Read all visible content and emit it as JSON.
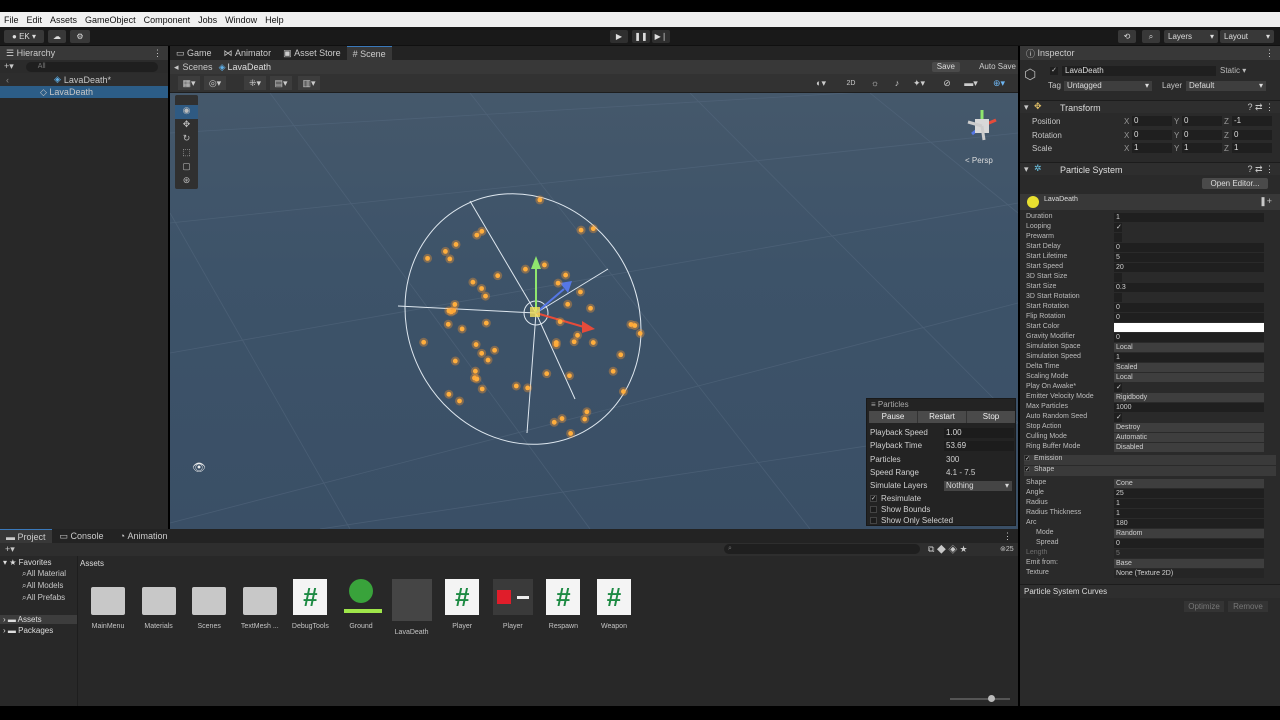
{
  "menu": [
    "File",
    "Edit",
    "Assets",
    "GameObject",
    "Component",
    "Jobs",
    "Window",
    "Help"
  ],
  "toolbar": {
    "account": "EK",
    "layers": "Layers",
    "layout": "Layout"
  },
  "hierarchy": {
    "title": "Hierarchy",
    "search_placeholder": "All",
    "scene": "LavaDeath*",
    "object": "LavaDeath"
  },
  "scene_tabs": [
    "Game",
    "Animator",
    "Asset Store",
    "Scene"
  ],
  "breadcrumb": {
    "root": "Scenes",
    "current": "LavaDeath"
  },
  "scene_header": {
    "save": "Save",
    "auto_save": "Auto Save",
    "mode_2d": "2D"
  },
  "viewport": {
    "persp": "Persp"
  },
  "particles_panel": {
    "title": "Particles",
    "buttons": [
      "Pause",
      "Restart",
      "Stop"
    ],
    "playback_speed_label": "Playback Speed",
    "playback_speed": "1.00",
    "playback_time_label": "Playback Time",
    "playback_time": "53.69",
    "particles_label": "Particles",
    "particles": "300",
    "speed_range_label": "Speed Range",
    "speed_range": "4.1 - 7.5",
    "simulate_layers_label": "Simulate Layers",
    "simulate_layers": "Nothing",
    "resimulate": "Resimulate",
    "show_bounds": "Show Bounds",
    "show_only_selected": "Show Only Selected"
  },
  "inspector": {
    "title": "Inspector",
    "object_name": "LavaDeath",
    "static": "Static",
    "tag_label": "Tag",
    "tag": "Untagged",
    "layer_label": "Layer",
    "layer": "Default",
    "transform": {
      "title": "Transform",
      "position_label": "Position",
      "position": [
        "0",
        "0",
        "-1"
      ],
      "rotation_label": "Rotation",
      "rotation": [
        "0",
        "0",
        "0"
      ],
      "scale_label": "Scale",
      "scale": [
        "1",
        "1",
        "1"
      ]
    },
    "particle_system": {
      "title": "Particle System",
      "open_editor": "Open Editor...",
      "module_name": "LavaDeath"
    },
    "props": [
      {
        "label": "Duration",
        "value": "1"
      },
      {
        "label": "Looping",
        "value": "✓"
      },
      {
        "label": "Prewarm",
        "value": ""
      },
      {
        "label": "Start Delay",
        "value": "0"
      },
      {
        "label": "Start Lifetime",
        "value": "5"
      },
      {
        "label": "Start Speed",
        "value": "20"
      },
      {
        "label": "3D Start Size",
        "value": ""
      },
      {
        "label": "Start Size",
        "value": "0.3"
      },
      {
        "label": "3D Start Rotation",
        "value": ""
      },
      {
        "label": "Start Rotation",
        "value": "0"
      },
      {
        "label": "Flip Rotation",
        "value": "0"
      },
      {
        "label": "Start Color",
        "value": ""
      },
      {
        "label": "Gravity Modifier",
        "value": "0"
      },
      {
        "label": "Simulation Space",
        "value": "Local"
      },
      {
        "label": "Simulation Speed",
        "value": "1"
      },
      {
        "label": "Delta Time",
        "value": "Scaled"
      },
      {
        "label": "Scaling Mode",
        "value": "Local"
      },
      {
        "label": "Play On Awake*",
        "value": "✓"
      },
      {
        "label": "Emitter Velocity Mode",
        "value": "Rigidbody"
      },
      {
        "label": "Max Particles",
        "value": "1000"
      },
      {
        "label": "Auto Random Seed",
        "value": "✓"
      },
      {
        "label": "Stop Action",
        "value": "Destroy"
      },
      {
        "label": "Culling Mode",
        "value": "Automatic"
      },
      {
        "label": "Ring Buffer Mode",
        "value": "Disabled"
      }
    ],
    "emission": "Emission",
    "shape_module": "Shape",
    "shape_props": [
      {
        "label": "Shape",
        "value": "Cone"
      },
      {
        "label": "Angle",
        "value": "25"
      },
      {
        "label": "Radius",
        "value": "1"
      },
      {
        "label": "Radius Thickness",
        "value": "1"
      },
      {
        "label": "Arc",
        "value": "180"
      },
      {
        "label": "Mode",
        "value": "Random"
      },
      {
        "label": "Spread",
        "value": "0"
      },
      {
        "label": "Length",
        "value": "5"
      },
      {
        "label": "Emit from:",
        "value": "Base"
      },
      {
        "label": "Texture",
        "value": "None (Texture 2D)"
      }
    ],
    "curves": "Particle System Curves",
    "optimize": "Optimize",
    "remove": "Remove"
  },
  "bottom_tabs": [
    "Project",
    "Console",
    "Animation"
  ],
  "project": {
    "favorites": "Favorites",
    "fav_items": [
      "All Material",
      "All Models",
      "All Prefabs"
    ],
    "assets": "Assets",
    "packages": "Packages",
    "path": "Assets",
    "count": "25",
    "items": [
      {
        "name": "MainMenu",
        "kind": "folder"
      },
      {
        "name": "Materials",
        "kind": "folder"
      },
      {
        "name": "Scenes",
        "kind": "folder"
      },
      {
        "name": "TextMesh ...",
        "kind": "folder"
      },
      {
        "name": "DebugTools",
        "kind": "script"
      },
      {
        "name": "Ground",
        "kind": "material"
      },
      {
        "name": "LavaDeath",
        "kind": "prefab"
      },
      {
        "name": "Player",
        "kind": "script"
      },
      {
        "name": "Player",
        "kind": "prefab-red"
      },
      {
        "name": "Respawn",
        "kind": "script"
      },
      {
        "name": "Weapon",
        "kind": "script"
      }
    ]
  },
  "colors": {
    "accent": "#2c5d87",
    "particle": "#ffae3d",
    "script_green": "#1d8a43"
  }
}
